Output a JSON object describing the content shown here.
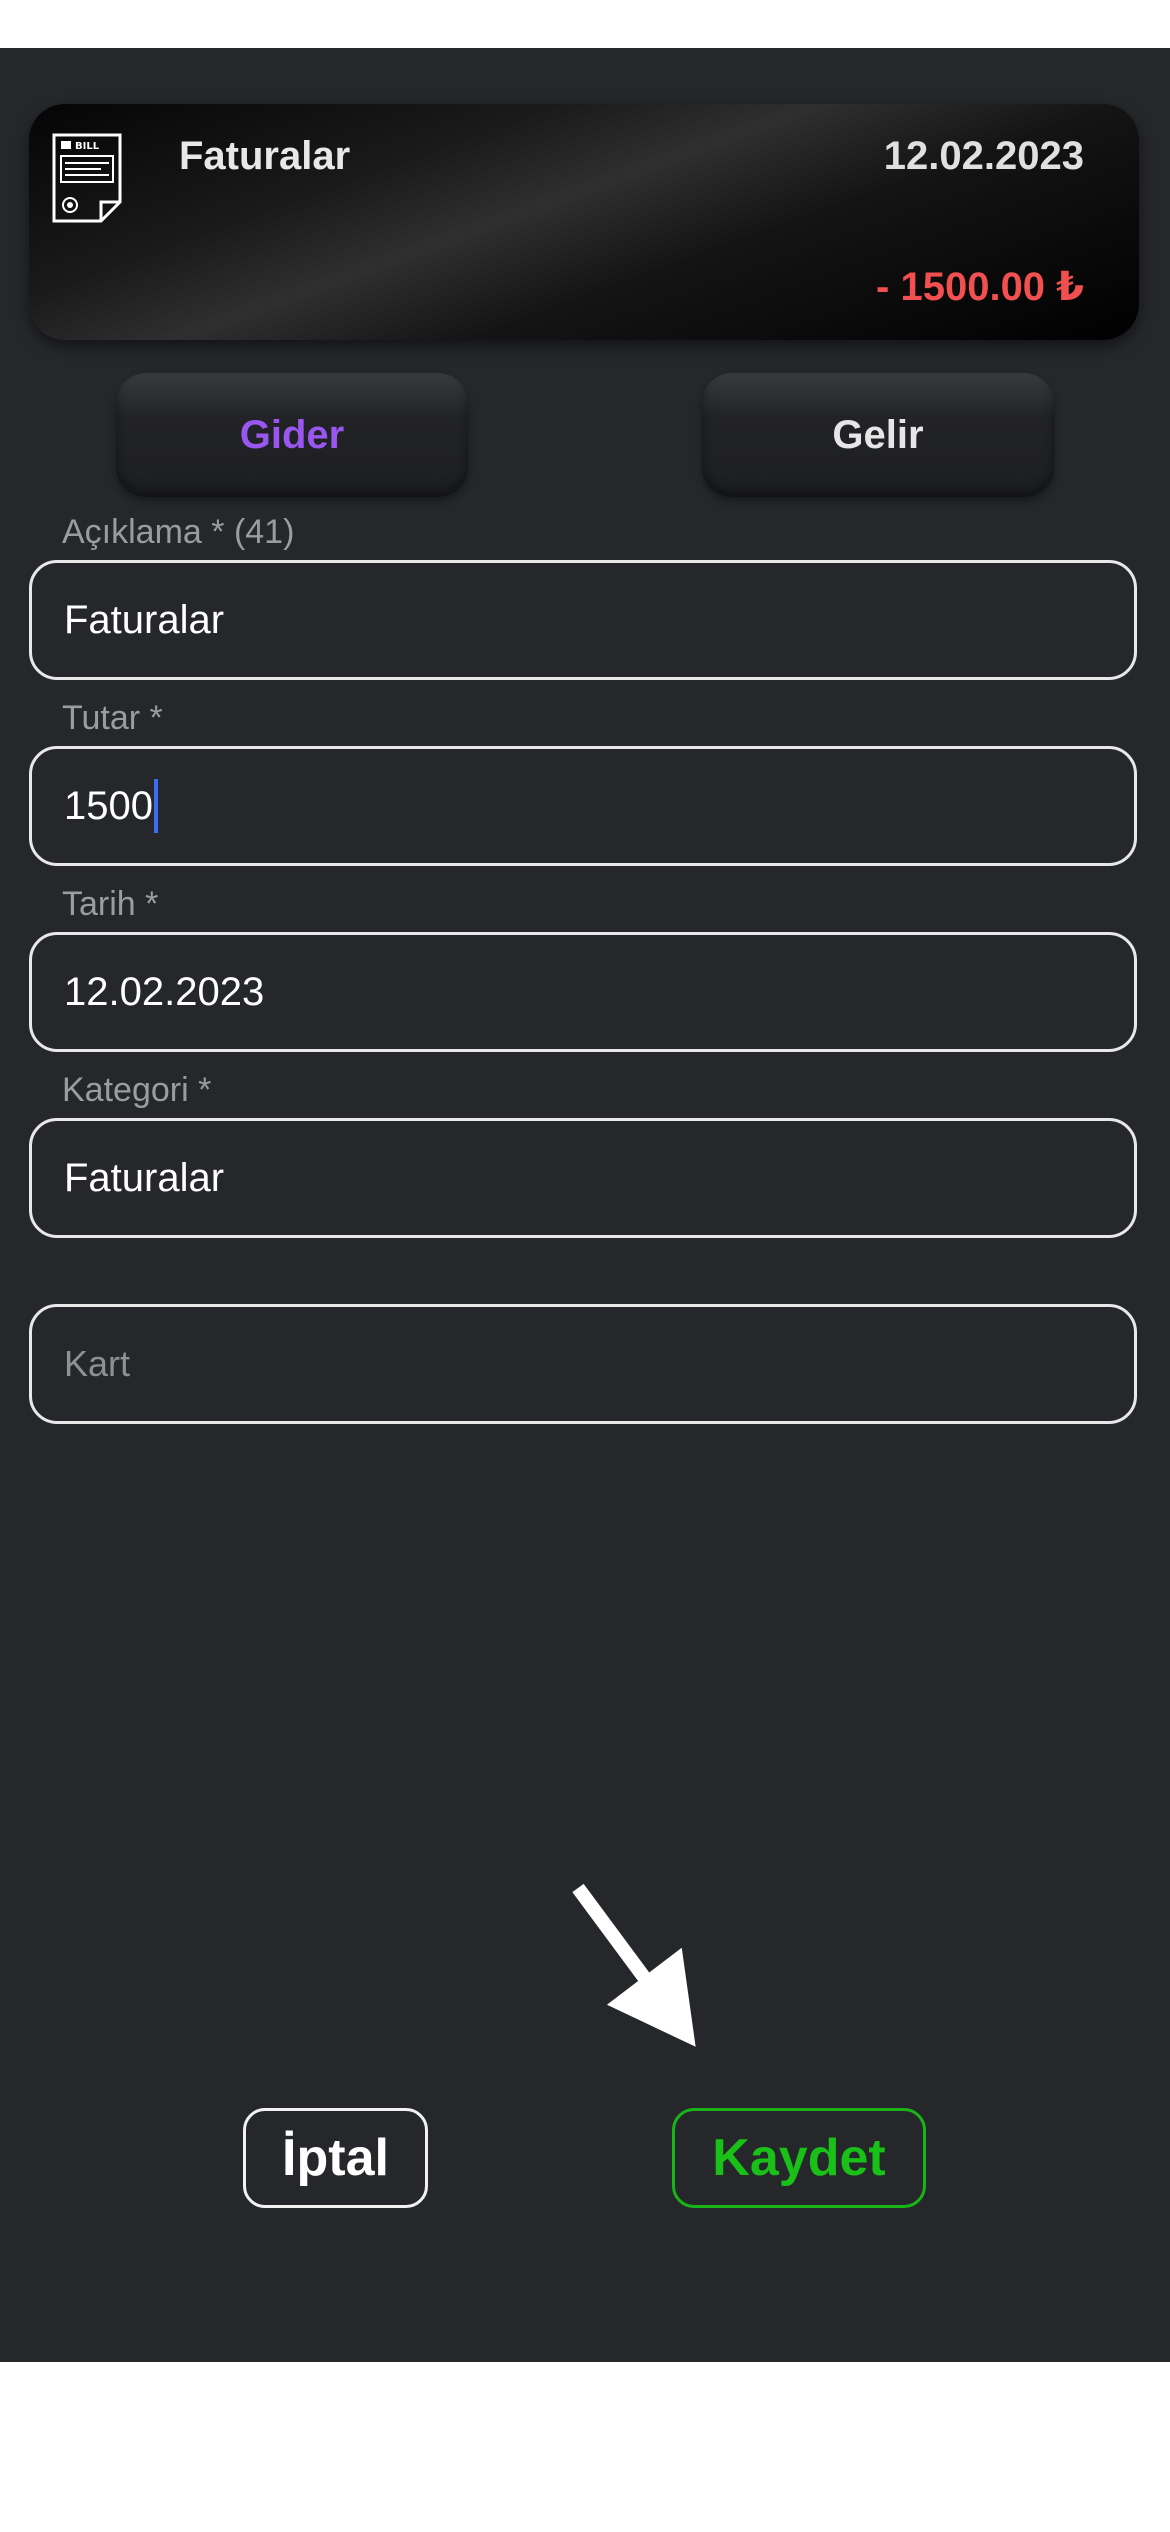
{
  "card": {
    "icon": "bill-icon",
    "icon_text": "BILL",
    "title": "Faturalar",
    "date": "12.02.2023",
    "amount": "- 1500.00 ₺",
    "amount_color": "#f25050"
  },
  "type_toggle": {
    "expense_label": "Gider",
    "income_label": "Gelir",
    "selected": "Gider",
    "selected_color": "#9a57f0"
  },
  "form": {
    "description_label": "Açıklama * (41)",
    "description_value": "Faturalar",
    "amount_label": "Tutar *",
    "amount_value": "1500",
    "date_label": "Tarih *",
    "date_value": "12.02.2023",
    "category_label": "Kategori *",
    "category_value": "Faturalar",
    "card_placeholder": "Kart"
  },
  "actions": {
    "cancel_label": "İptal",
    "save_label": "Kaydet",
    "save_color": "#18c018"
  },
  "overlay": {
    "arrow_icon": "arrow-down-right-icon"
  }
}
